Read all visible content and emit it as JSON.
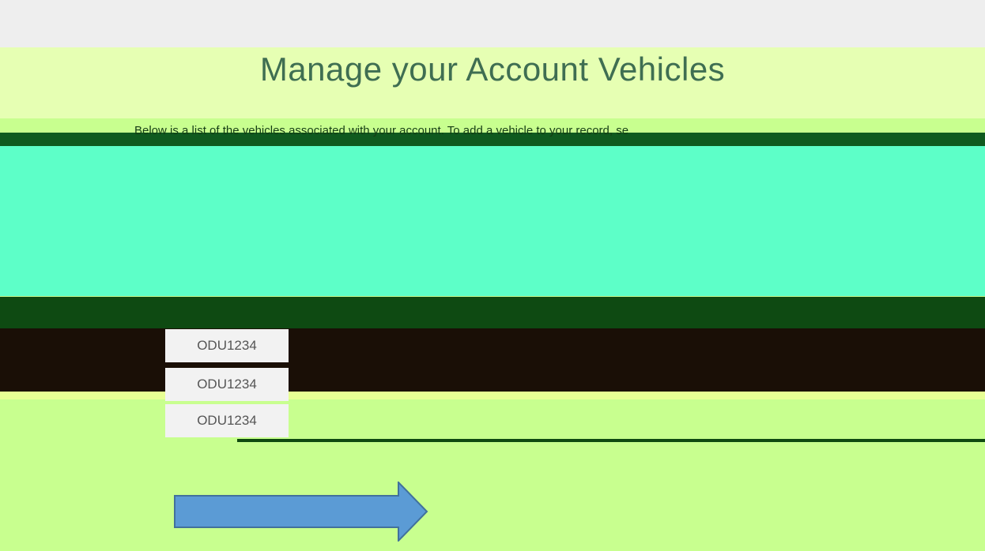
{
  "page": {
    "title": "Manage your Account Vehicles",
    "description": "Below is a list of the vehicles associated with your account. To add a vehicle to your record, se"
  },
  "vehicles": [
    {
      "plate": "ODU1234"
    },
    {
      "plate": "ODU1234"
    },
    {
      "plate": "ODU1234"
    }
  ],
  "colors": {
    "accent": "#5b9bd5",
    "title": "#3f6e52",
    "teal": "#5dffc8",
    "lime": "#c8ff8f"
  },
  "icons": {
    "arrow": "right-arrow-icon"
  }
}
